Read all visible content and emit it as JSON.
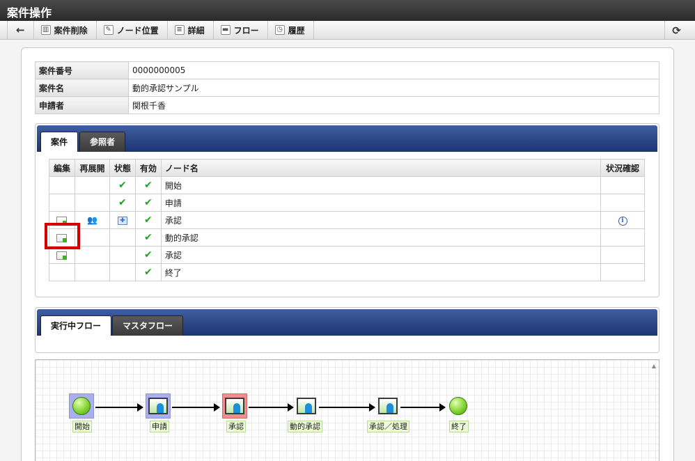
{
  "window": {
    "title": "案件操作"
  },
  "toolbar": {
    "items": [
      {
        "label": "案件削除",
        "icon": "trash-icon"
      },
      {
        "label": "ノード位置",
        "icon": "node-position-icon"
      },
      {
        "label": "詳細",
        "icon": "detail-icon"
      },
      {
        "label": "フロー",
        "icon": "flow-icon"
      },
      {
        "label": "履歴",
        "icon": "history-icon"
      }
    ],
    "back_icon": "←",
    "refresh_icon": "⟳"
  },
  "info": {
    "rows": [
      {
        "label": "案件番号",
        "value": "0000000005"
      },
      {
        "label": "案件名",
        "value": "動的承認サンプル"
      },
      {
        "label": "申請者",
        "value": "関根千香"
      }
    ]
  },
  "case_tabs": {
    "tabs": [
      "案件",
      "参照者"
    ],
    "active": 0
  },
  "node_table": {
    "headers": [
      "編集",
      "再展開",
      "状態",
      "有効",
      "ノード名",
      "状況確認"
    ],
    "rows": [
      {
        "name": "開始",
        "edit": false,
        "reopen": false,
        "state": "check",
        "valid": true,
        "status_info": false
      },
      {
        "name": "申請",
        "edit": false,
        "reopen": false,
        "state": "check",
        "valid": true,
        "status_info": false
      },
      {
        "name": "承認",
        "edit": true,
        "reopen": true,
        "state": "processing",
        "valid": true,
        "status_info": true
      },
      {
        "name": "動的承認",
        "edit": true,
        "reopen": false,
        "state": "",
        "valid": true,
        "status_info": false
      },
      {
        "name": "承認",
        "edit": true,
        "reopen": false,
        "state": "",
        "valid": true,
        "status_info": false
      },
      {
        "name": "終了",
        "edit": false,
        "reopen": false,
        "state": "check",
        "valid": true,
        "status_info": false
      }
    ]
  },
  "flow_tabs": {
    "tabs": [
      "実行中フロー",
      "マスタフロー"
    ],
    "active": 0
  },
  "flow": {
    "nodes": [
      {
        "label": "開始",
        "type": "start",
        "state": "done"
      },
      {
        "label": "申請",
        "type": "task",
        "state": "done"
      },
      {
        "label": "承認",
        "type": "task",
        "state": "current"
      },
      {
        "label": "動的承認",
        "type": "task",
        "state": "pending"
      },
      {
        "label": "承認／処理",
        "type": "task",
        "state": "pending"
      },
      {
        "label": "終了",
        "type": "end",
        "state": "pending"
      }
    ]
  }
}
